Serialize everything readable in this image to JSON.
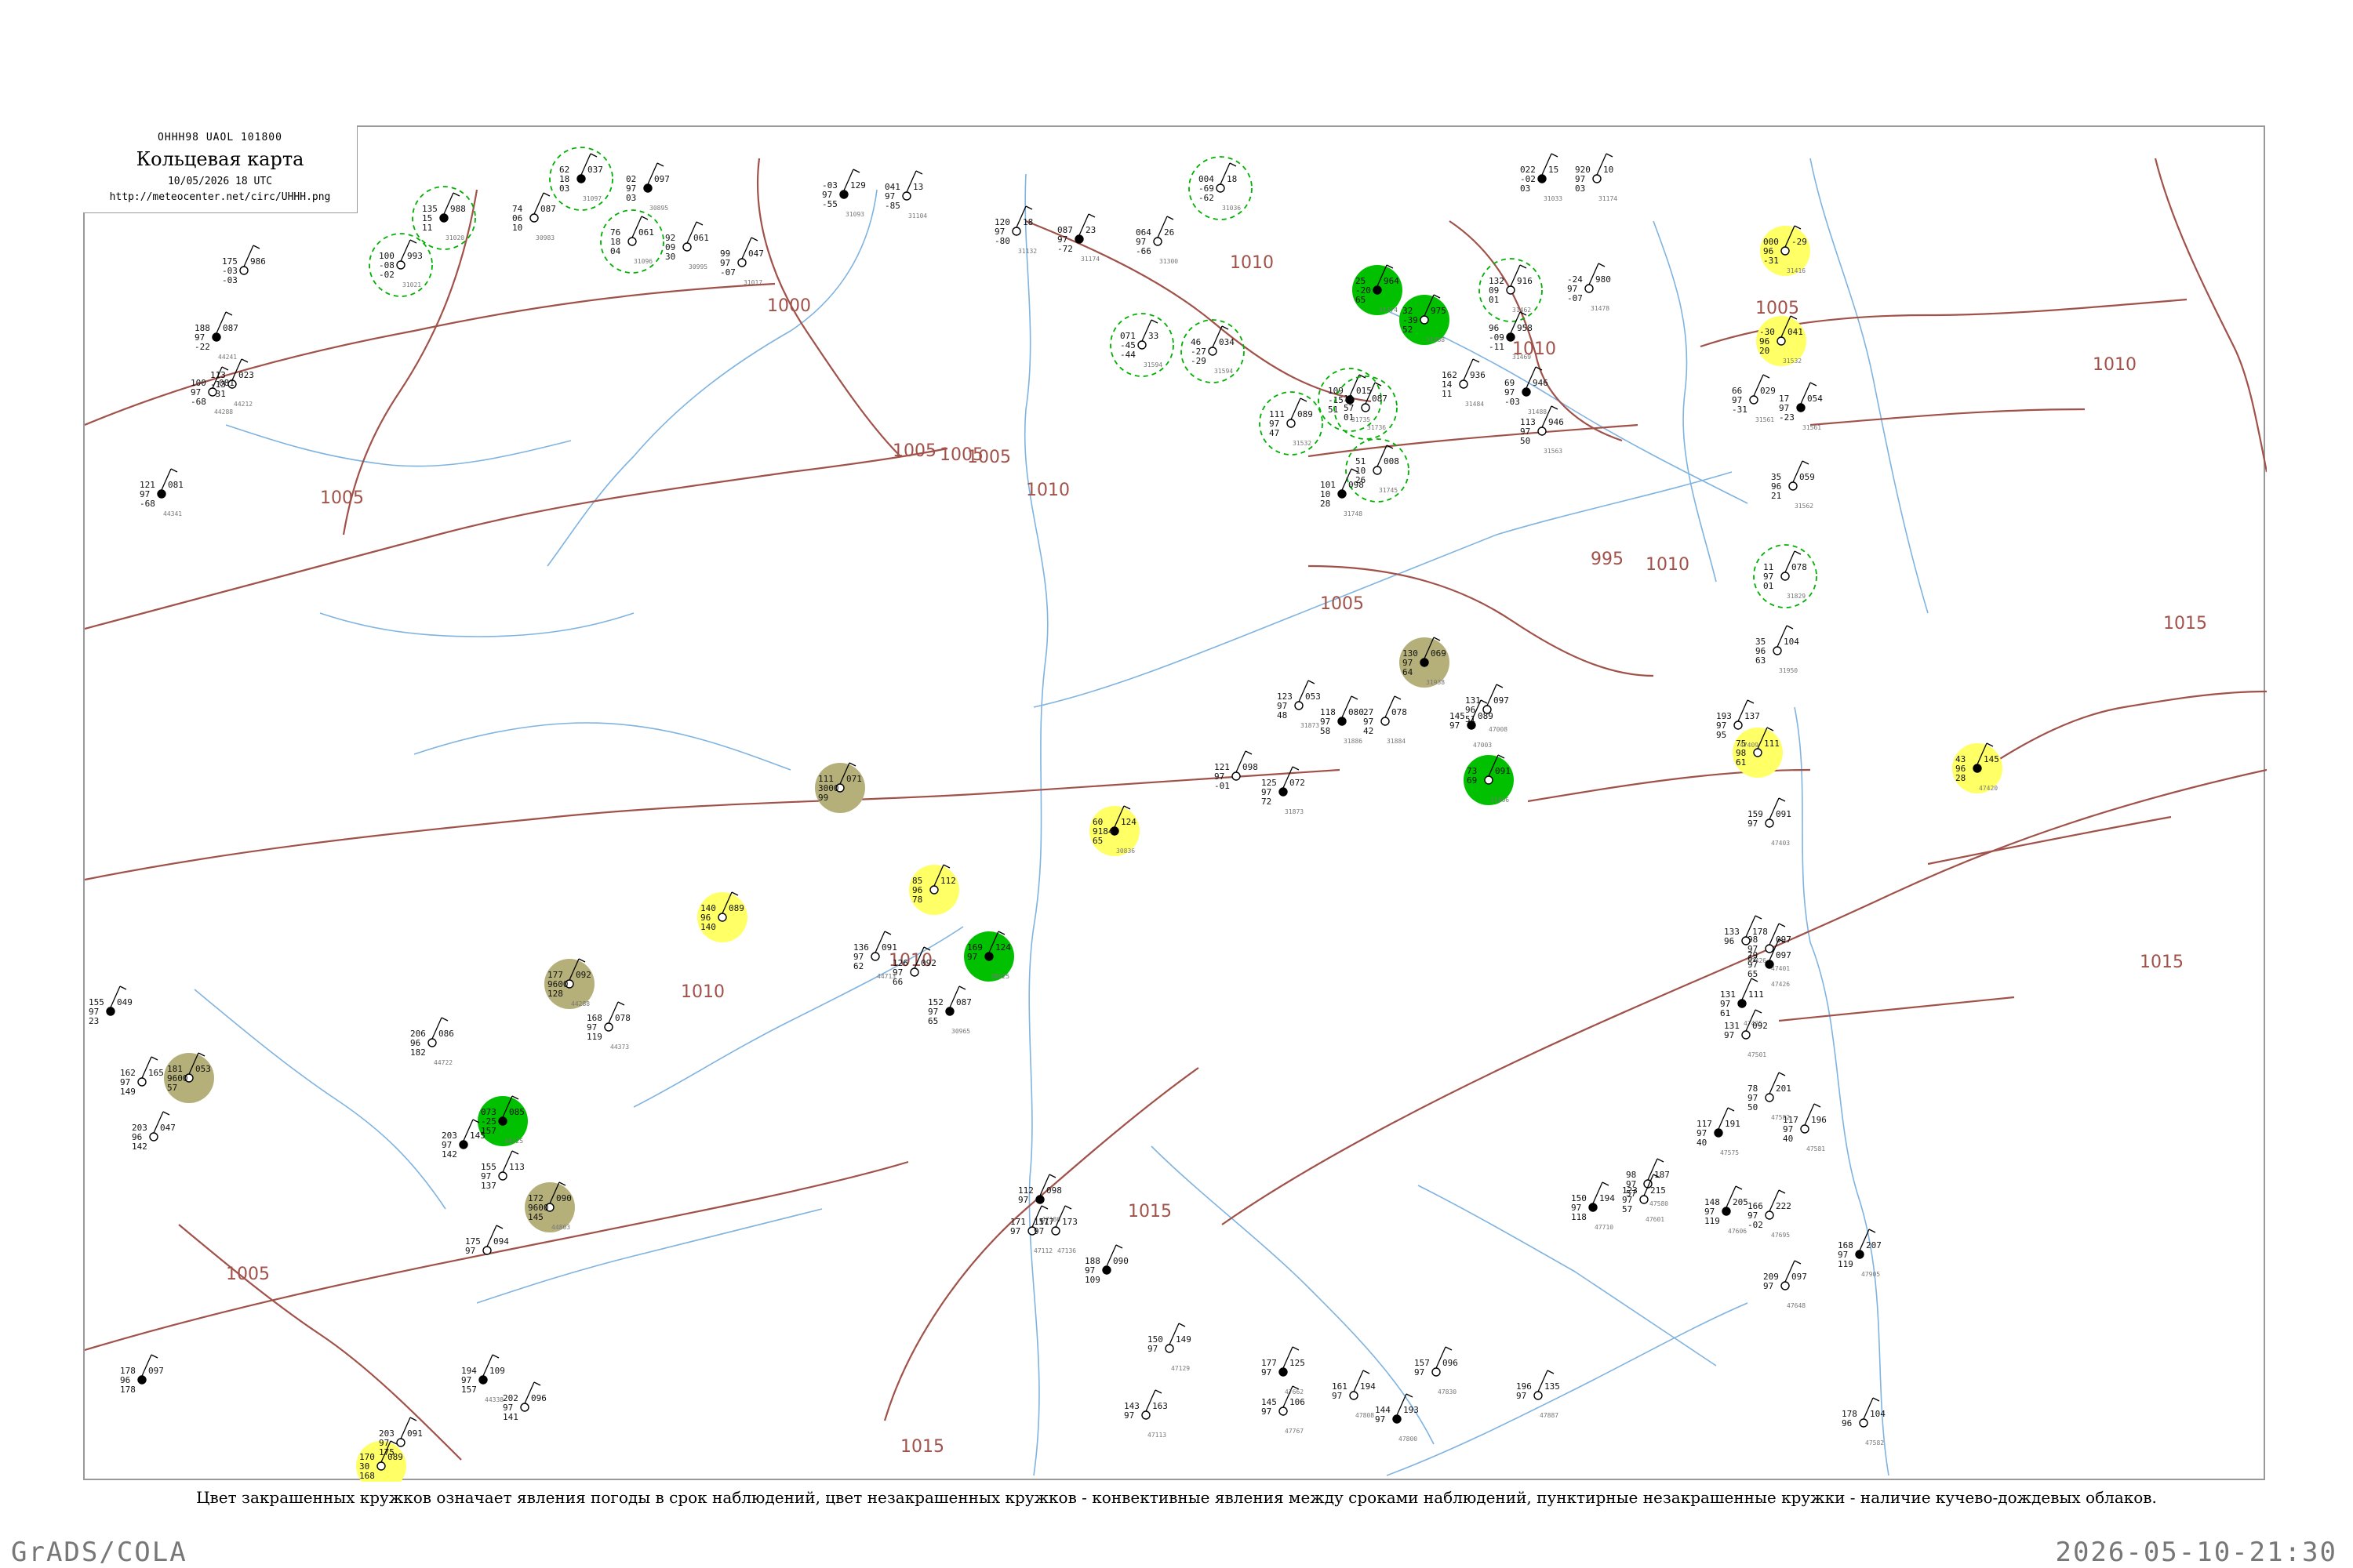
{
  "title_box": {
    "header": "ОННН98  UAOL  101800",
    "title": "Кольцевая карта",
    "datetime": "10/05/2026 18 UTC",
    "url": "http://meteocenter.net/circ/UHHH.png"
  },
  "caption": "Цвет закрашенных кружков означает явления погоды в срок наблюдений, цвет незакрашенных кружков - конвективные явления между сроками наблюдений, пунктирные незакрашенные кружки - наличие кучево-дождевых облаков.",
  "footer": {
    "left": "GrADS/COLA",
    "right": "2026-05-10-21:30"
  },
  "colors": {
    "isobar": "#a0524a",
    "river": "#7fb3e0",
    "border": "#999999",
    "green": "#00c000",
    "olive": "#b5b07a",
    "yellow": "#ffff66",
    "green_dashed": "#00b000"
  },
  "isobar_labels": [
    "1000",
    "1005",
    "1005",
    "1005",
    "1010",
    "1010",
    "1010",
    "1010",
    "995",
    "1005",
    "1010",
    "1015",
    "1015",
    "1015",
    "1015",
    "1010",
    "1005",
    "1005",
    "1010",
    "1005"
  ],
  "stations": [
    {
      "p": "135",
      "t": "988",
      "b": "15",
      "d": "11",
      "n": "31020",
      "marker": "green-dashed"
    },
    {
      "p": "100",
      "t": "993",
      "b": "-08",
      "d": "-02",
      "n": "31021",
      "marker": "green-dashed"
    },
    {
      "p": "175",
      "t": "986",
      "b": "-03",
      "d": "-03",
      "n": "",
      "marker": ""
    },
    {
      "p": "62",
      "t": "037",
      "b": "18",
      "d": "03",
      "n": "31097",
      "marker": "green-dashed"
    },
    {
      "p": "76",
      "t": "061",
      "b": "18",
      "d": "04",
      "n": "31096",
      "marker": "green-dashed"
    },
    {
      "p": "74",
      "t": "087",
      "b": "06",
      "d": "10",
      "n": "30983",
      "marker": ""
    },
    {
      "p": "02",
      "t": "097",
      "b": "97",
      "d": "03",
      "n": "30895",
      "marker": ""
    },
    {
      "p": "92",
      "t": "061",
      "b": "09",
      "d": "30",
      "n": "30995",
      "marker": ""
    },
    {
      "p": "99",
      "t": "047",
      "b": "97",
      "d": "-07",
      "n": "31017",
      "marker": ""
    },
    {
      "p": "-03",
      "t": "129",
      "b": "97",
      "d": "-55",
      "n": "31093",
      "marker": ""
    },
    {
      "p": "041",
      "t": "13",
      "b": "97",
      "d": "-85",
      "n": "31104",
      "marker": ""
    },
    {
      "p": "120",
      "t": "18",
      "b": "97",
      "d": "-80",
      "n": "31132",
      "marker": ""
    },
    {
      "p": "087",
      "t": "23",
      "b": "97",
      "d": "-72",
      "n": "31174",
      "marker": ""
    },
    {
      "p": "064",
      "t": "26",
      "b": "97",
      "d": "-66",
      "n": "31300",
      "marker": ""
    },
    {
      "p": "004",
      "t": "18",
      "b": "-69",
      "d": "-62",
      "n": "31036",
      "marker": "green-dashed"
    },
    {
      "p": "022",
      "t": "15",
      "b": "-02",
      "d": "03",
      "n": "31033",
      "marker": ""
    },
    {
      "p": "920",
      "t": "10",
      "b": "97",
      "d": "03",
      "n": "31174",
      "marker": ""
    },
    {
      "p": "000",
      "t": "-29",
      "b": "96",
      "d": "-31",
      "n": "31416",
      "marker": "yellow"
    },
    {
      "p": "25",
      "t": "964",
      "b": "-20",
      "d": "65",
      "n": "31374",
      "marker": "green"
    },
    {
      "p": "32",
      "t": "975",
      "b": "-39",
      "d": "52",
      "n": "31388",
      "marker": "green"
    },
    {
      "p": "132",
      "t": "916",
      "b": "09",
      "d": "01",
      "n": "31462",
      "marker": "green-dashed"
    },
    {
      "p": "96",
      "t": "958",
      "b": "-09",
      "d": "-11",
      "n": "31469",
      "marker": ""
    },
    {
      "p": "-24",
      "t": "980",
      "b": "97",
      "d": "-07",
      "n": "31478",
      "marker": ""
    },
    {
      "p": "-30",
      "t": "041",
      "b": "96",
      "d": "20",
      "n": "31532",
      "marker": "yellow"
    },
    {
      "p": "188",
      "t": "087",
      "b": "97",
      "d": "-22",
      "n": "44241",
      "marker": ""
    },
    {
      "p": "113",
      "t": "023",
      "b": "-13",
      "d": "-31",
      "n": "44212",
      "marker": ""
    },
    {
      "p": "100",
      "t": "081",
      "b": "97",
      "d": "-68",
      "n": "44288",
      "marker": ""
    },
    {
      "p": "121",
      "t": "081",
      "b": "97",
      "d": "-68",
      "n": "44341",
      "marker": ""
    },
    {
      "p": "071",
      "t": "33",
      "b": "-45",
      "d": "-44",
      "n": "31594",
      "marker": "green-dashed"
    },
    {
      "p": "46",
      "t": "034",
      "b": "-27",
      "d": "-29",
      "n": "31594",
      "marker": "green-dashed"
    },
    {
      "p": "109",
      "t": "015",
      "b": "-15",
      "d": "51",
      "n": "31735",
      "marker": "green-dashed"
    },
    {
      "p": "11",
      "t": "087",
      "b": "57",
      "d": "01",
      "n": "31736",
      "marker": "green-dashed"
    },
    {
      "p": "51",
      "t": "008",
      "b": "10",
      "d": "26",
      "n": "31745",
      "marker": "green-dashed"
    },
    {
      "p": "101",
      "t": "098",
      "b": "10",
      "d": "28",
      "n": "31748",
      "marker": ""
    },
    {
      "p": "111",
      "t": "089",
      "b": "97",
      "d": "47",
      "n": "31532",
      "marker": "green-dashed"
    },
    {
      "p": "162",
      "t": "936",
      "b": "14",
      "d": "11",
      "n": "31484",
      "marker": ""
    },
    {
      "p": "69",
      "t": "946",
      "b": "97",
      "d": "-03",
      "n": "31488",
      "marker": ""
    },
    {
      "p": "113",
      "t": "946",
      "b": "97",
      "d": "50",
      "n": "31563",
      "marker": ""
    },
    {
      "p": "66",
      "t": "029",
      "b": "97",
      "d": "-31",
      "n": "31561",
      "marker": ""
    },
    {
      "p": "17",
      "t": "054",
      "b": "97",
      "d": "-23",
      "n": "31561",
      "marker": ""
    },
    {
      "p": "35",
      "t": "059",
      "b": "96",
      "d": "21",
      "n": "31562",
      "marker": ""
    },
    {
      "p": "11",
      "t": "078",
      "b": "97",
      "d": "01",
      "n": "31829",
      "marker": "green-dashed"
    },
    {
      "p": "130",
      "t": "069",
      "b": "97",
      "d": "64",
      "n": "31938",
      "marker": "olive"
    },
    {
      "p": "35",
      "t": "104",
      "b": "96",
      "d": "63",
      "n": "31950",
      "marker": ""
    },
    {
      "p": "111",
      "t": "071",
      "b": "3000",
      "d": "99",
      "n": "",
      "marker": "olive"
    },
    {
      "p": "60",
      "t": "124",
      "b": "9184",
      "d": "65",
      "n": "30836",
      "marker": "yellow"
    },
    {
      "p": "85",
      "t": "112",
      "b": "96",
      "d": "78",
      "n": "",
      "marker": "yellow"
    },
    {
      "p": "140",
      "t": "089",
      "b": "96",
      "d": "140",
      "n": "",
      "marker": "yellow"
    },
    {
      "p": "169",
      "t": "124",
      "b": "97",
      "d": "",
      "n": "30925",
      "marker": "green"
    },
    {
      "p": "73",
      "t": "091",
      "b": "69",
      "d": "",
      "n": "31866",
      "marker": "green"
    },
    {
      "p": "75",
      "t": "111",
      "b": "98",
      "d": "61",
      "n": "",
      "marker": "yellow"
    },
    {
      "p": "43",
      "t": "145",
      "b": "96",
      "d": "28",
      "n": "47420",
      "marker": "yellow"
    },
    {
      "p": "177",
      "t": "092",
      "b": "9600",
      "d": "128",
      "n": "44288",
      "marker": "olive"
    },
    {
      "p": "181",
      "t": "053",
      "b": "9600",
      "d": "57",
      "n": "",
      "marker": "olive"
    },
    {
      "p": "073",
      "t": "085",
      "b": "-25",
      "d": "157",
      "n": "44725",
      "marker": "green"
    },
    {
      "p": "172",
      "t": "090",
      "b": "9600",
      "d": "145",
      "n": "44803",
      "marker": "olive"
    },
    {
      "p": "170",
      "t": "089",
      "b": "30",
      "d": "168",
      "n": "",
      "marker": "yellow"
    },
    {
      "p": "152",
      "t": "087",
      "b": "97",
      "d": "65",
      "n": "30965",
      "marker": ""
    },
    {
      "p": "126",
      "t": "092",
      "b": "97",
      "d": "66",
      "n": "",
      "marker": ""
    },
    {
      "p": "136",
      "t": "091",
      "b": "97",
      "d": "62",
      "n": "44713",
      "marker": ""
    },
    {
      "p": "155",
      "t": "049",
      "b": "97",
      "d": "23",
      "n": "",
      "marker": ""
    },
    {
      "p": "162",
      "t": "165",
      "b": "97",
      "d": "149",
      "n": "",
      "marker": ""
    },
    {
      "p": "203",
      "t": "047",
      "b": "96",
      "d": "142",
      "n": "",
      "marker": ""
    },
    {
      "p": "125",
      "t": "072",
      "b": "97",
      "d": "72",
      "n": "31873",
      "marker": ""
    },
    {
      "p": "121",
      "t": "098",
      "b": "97",
      "d": "-01",
      "n": "",
      "marker": ""
    },
    {
      "p": "123",
      "t": "053",
      "b": "97",
      "d": "48",
      "n": "31873",
      "marker": ""
    },
    {
      "p": "118",
      "t": "080",
      "b": "97",
      "d": "58",
      "n": "31886",
      "marker": ""
    },
    {
      "p": "27",
      "t": "078",
      "b": "97",
      "d": "42",
      "n": "31884",
      "marker": ""
    },
    {
      "p": "131",
      "t": "097",
      "b": "96",
      "d": "51",
      "n": "47008",
      "marker": ""
    },
    {
      "p": "145",
      "t": "089",
      "b": "97",
      "d": "",
      "n": "47003",
      "marker": ""
    },
    {
      "p": "193",
      "t": "137",
      "b": "97",
      "d": "95",
      "n": "47409",
      "marker": ""
    },
    {
      "p": "159",
      "t": "091",
      "b": "97",
      "d": "",
      "n": "47403",
      "marker": ""
    },
    {
      "p": "79",
      "t": "097",
      "b": "97",
      "d": "65",
      "n": "47426",
      "marker": ""
    },
    {
      "p": "98",
      "t": "097",
      "b": "97",
      "d": "62",
      "n": "47401",
      "marker": ""
    },
    {
      "p": "133",
      "t": "178",
      "b": "96",
      "d": "",
      "n": "47426",
      "marker": ""
    },
    {
      "p": "131",
      "t": "111",
      "b": "97",
      "d": "61",
      "n": "47425",
      "marker": ""
    },
    {
      "p": "131",
      "t": "092",
      "b": "97",
      "d": "",
      "n": "47501",
      "marker": ""
    },
    {
      "p": "78",
      "t": "201",
      "b": "97",
      "d": "50",
      "n": "47582",
      "marker": ""
    },
    {
      "p": "117",
      "t": "191",
      "b": "97",
      "d": "40",
      "n": "47575",
      "marker": ""
    },
    {
      "p": "98",
      "t": "187",
      "b": "97",
      "d": "57",
      "n": "47580",
      "marker": ""
    },
    {
      "p": "123",
      "t": "215",
      "b": "97",
      "d": "57",
      "n": "47601",
      "marker": ""
    },
    {
      "p": "148",
      "t": "205",
      "b": "97",
      "d": "119",
      "n": "47606",
      "marker": ""
    },
    {
      "p": "166",
      "t": "222",
      "b": "97",
      "d": "-02",
      "n": "47695",
      "marker": ""
    },
    {
      "p": "209",
      "t": "097",
      "b": "97",
      "d": "",
      "n": "47648",
      "marker": ""
    },
    {
      "p": "168",
      "t": "207",
      "b": "97",
      "d": "119",
      "n": "47905",
      "marker": ""
    },
    {
      "p": "178",
      "t": "104",
      "b": "96",
      "d": "",
      "n": "47582",
      "marker": ""
    },
    {
      "p": "117",
      "t": "196",
      "b": "97",
      "d": "40",
      "n": "47581",
      "marker": ""
    },
    {
      "p": "150",
      "t": "194",
      "b": "97",
      "d": "118",
      "n": "47710",
      "marker": ""
    },
    {
      "p": "196",
      "t": "135",
      "b": "97",
      "d": "",
      "n": "47887",
      "marker": ""
    },
    {
      "p": "157",
      "t": "096",
      "b": "97",
      "d": "",
      "n": "47830",
      "marker": ""
    },
    {
      "p": "144",
      "t": "193",
      "b": "97",
      "d": "",
      "n": "47800",
      "marker": ""
    },
    {
      "p": "161",
      "t": "194",
      "b": "97",
      "d": "",
      "n": "47808",
      "marker": ""
    },
    {
      "p": "145",
      "t": "106",
      "b": "97",
      "d": "",
      "n": "47767",
      "marker": ""
    },
    {
      "p": "177",
      "t": "125",
      "b": "97",
      "d": "",
      "n": "47662",
      "marker": ""
    },
    {
      "p": "150",
      "t": "149",
      "b": "97",
      "d": "",
      "n": "47129",
      "marker": ""
    },
    {
      "p": "143",
      "t": "163",
      "b": "97",
      "d": "",
      "n": "47113",
      "marker": ""
    },
    {
      "p": "112",
      "t": "098",
      "b": "97",
      "d": "",
      "n": "47186",
      "marker": ""
    },
    {
      "p": "171",
      "t": "177",
      "b": "97",
      "d": "",
      "n": "47112",
      "marker": ""
    },
    {
      "p": "151",
      "t": "173",
      "b": "97",
      "d": "",
      "n": "47136",
      "marker": ""
    },
    {
      "p": "188",
      "t": "090",
      "b": "97",
      "d": "109",
      "n": "",
      "marker": ""
    },
    {
      "p": "168",
      "t": "078",
      "b": "97",
      "d": "119",
      "n": "44373",
      "marker": ""
    },
    {
      "p": "206",
      "t": "086",
      "b": "96",
      "d": "182",
      "n": "44722",
      "marker": ""
    },
    {
      "p": "203",
      "t": "145",
      "b": "97",
      "d": "142",
      "n": "",
      "marker": ""
    },
    {
      "p": "155",
      "t": "113",
      "b": "97",
      "d": "137",
      "n": "",
      "marker": ""
    },
    {
      "p": "175",
      "t": "094",
      "b": "97",
      "d": "",
      "n": "",
      "marker": ""
    },
    {
      "p": "194",
      "t": "109",
      "b": "97",
      "d": "157",
      "n": "44338",
      "marker": ""
    },
    {
      "p": "202",
      "t": "096",
      "b": "97",
      "d": "141",
      "n": "",
      "marker": ""
    },
    {
      "p": "203",
      "t": "091",
      "b": "97",
      "d": "175",
      "n": "",
      "marker": ""
    },
    {
      "p": "178",
      "t": "097",
      "b": "96",
      "d": "178",
      "n": "",
      "marker": ""
    }
  ]
}
